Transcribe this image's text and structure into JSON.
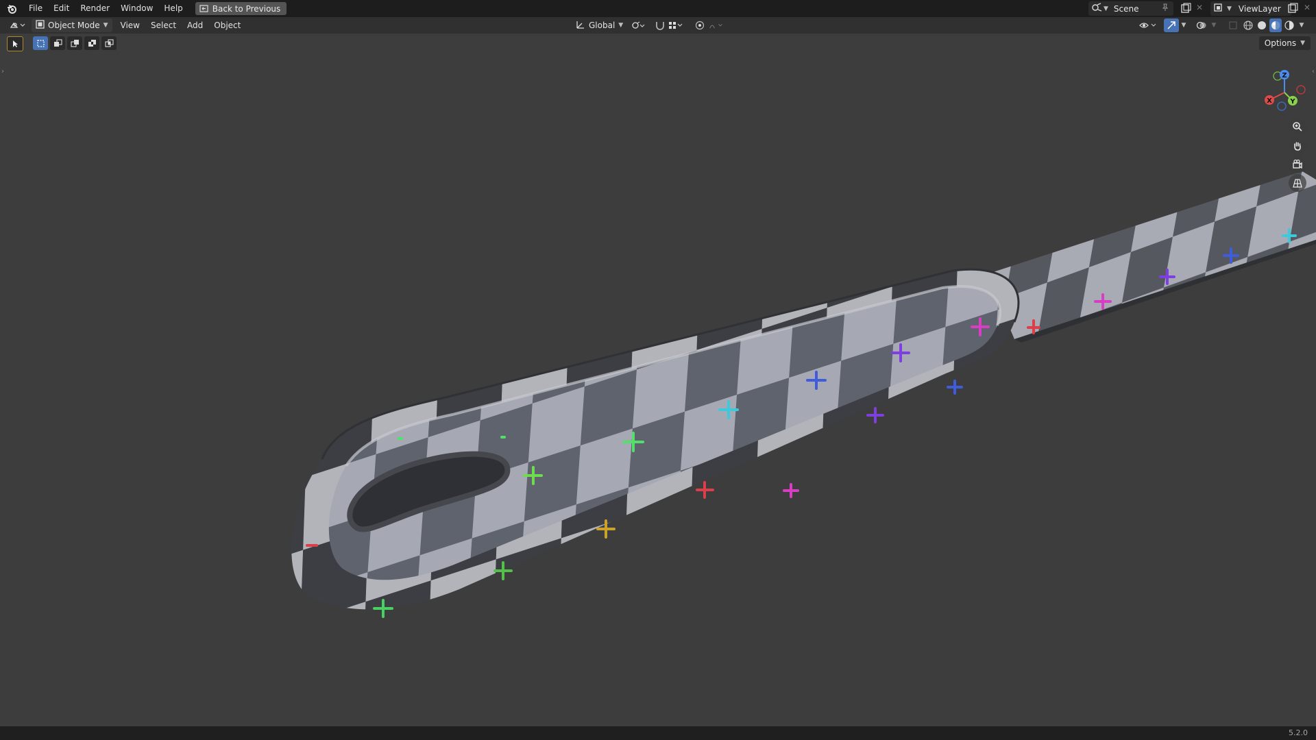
{
  "topbar": {
    "menus": [
      "File",
      "Edit",
      "Render",
      "Window",
      "Help"
    ],
    "back_label": "Back to Previous",
    "scene_label": "Scene",
    "viewlayer_label": "ViewLayer"
  },
  "header": {
    "mode_label": "Object Mode",
    "menus": [
      "View",
      "Select",
      "Add",
      "Object"
    ],
    "orientation_label": "Global",
    "options_label": "Options"
  },
  "gizmo": {
    "x": "X",
    "y": "Y",
    "z": "Z"
  },
  "status": {
    "version": "5.2.0"
  }
}
